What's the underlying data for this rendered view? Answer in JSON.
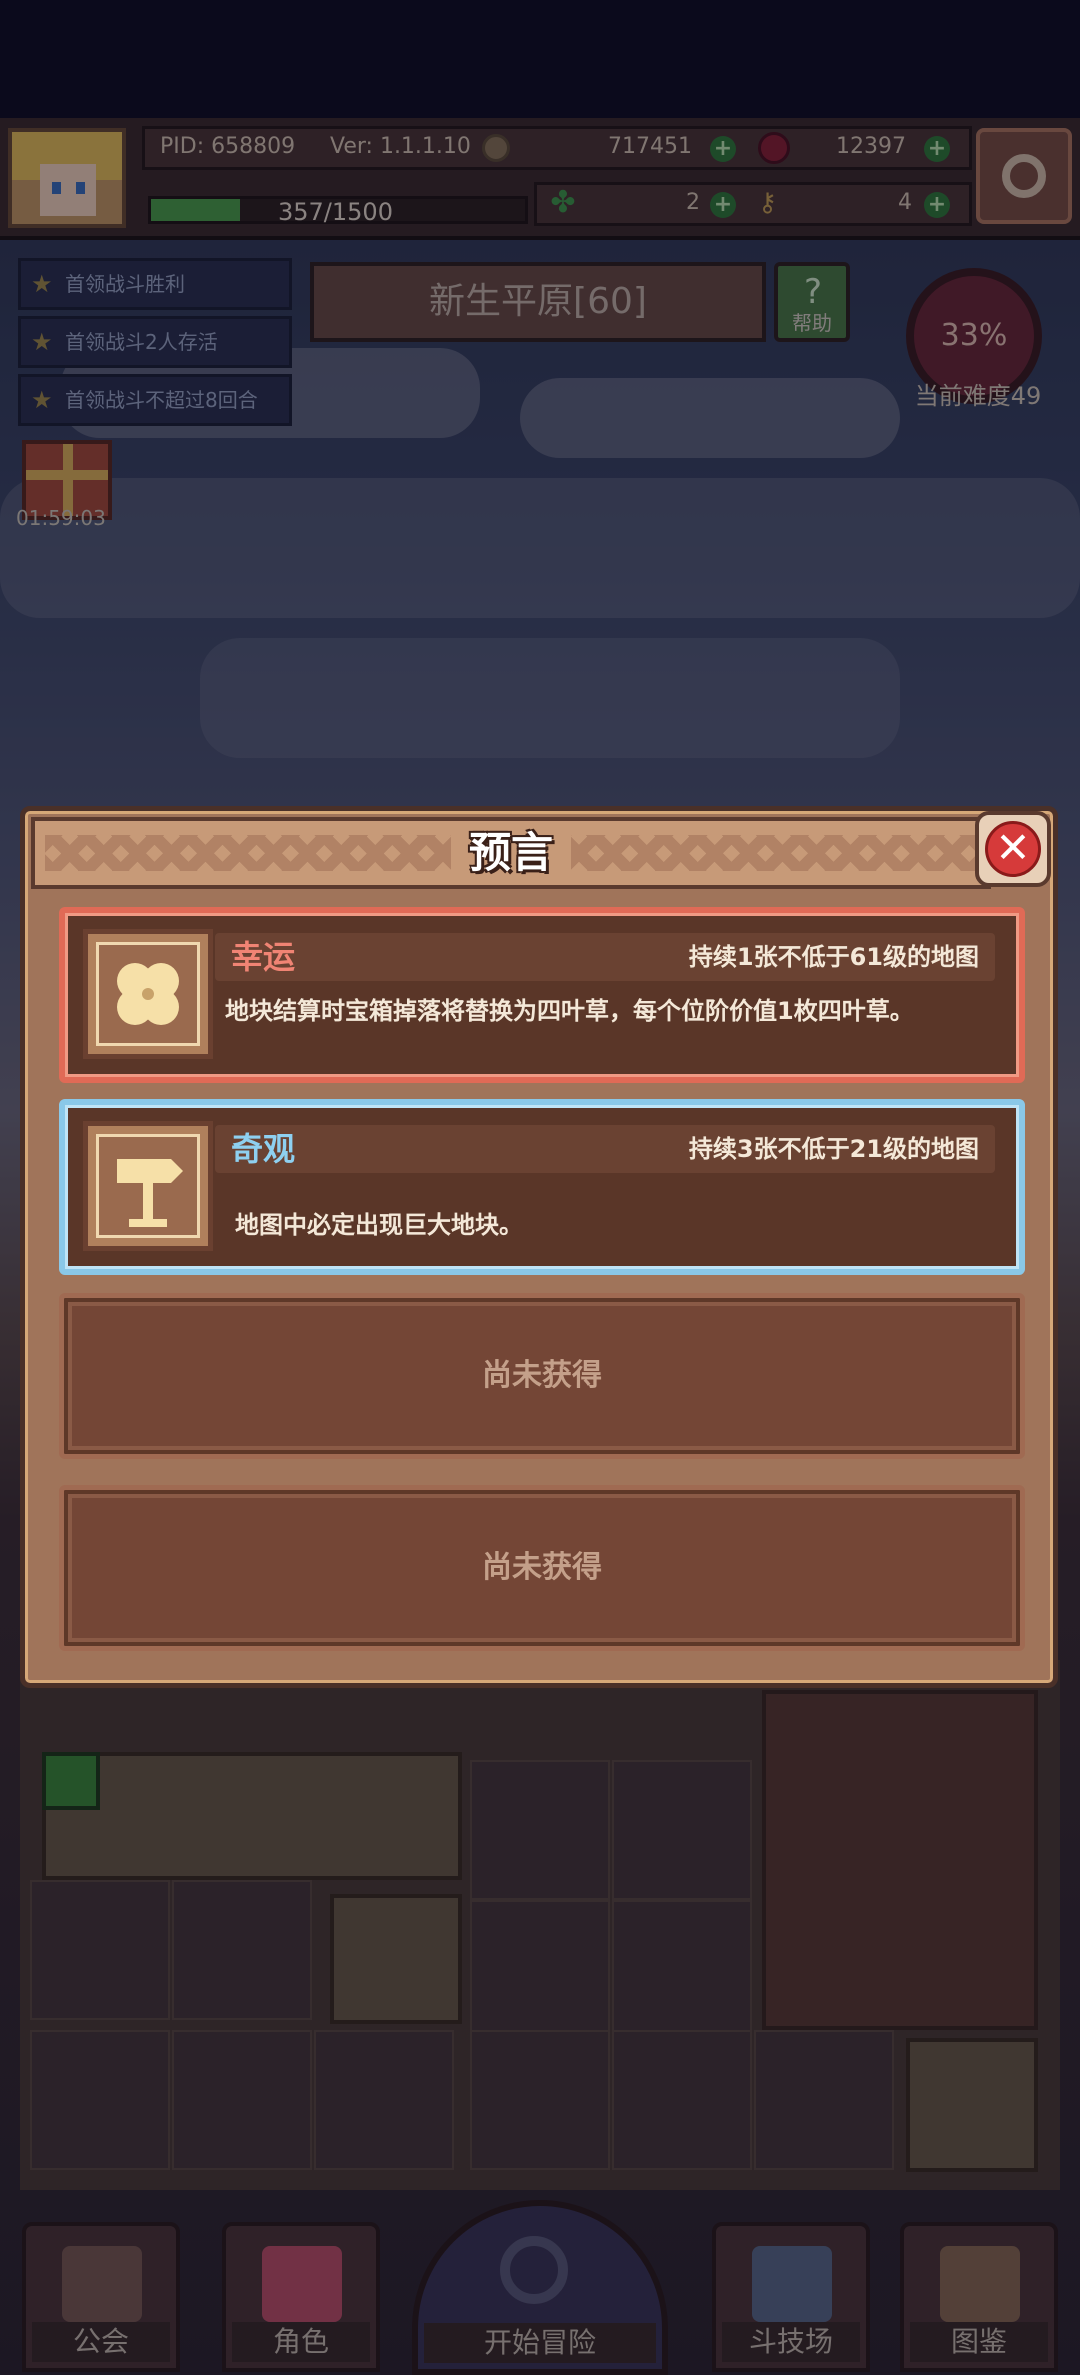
{
  "hud": {
    "pid": "PID: 658809",
    "version": "Ver: 1.1.1.10",
    "gold": "717451",
    "gems": "12397",
    "stamina": "357/1500",
    "stamina_fraction": 0.238,
    "clover_count": "2",
    "key_count": "4"
  },
  "quests": [
    "首领战斗胜利",
    "首领战斗2人存活",
    "首领战斗不超过8回合"
  ],
  "area": {
    "title": "新生平原[60]",
    "help_label": "帮助"
  },
  "difficulty": {
    "percent": "33%",
    "label": "当前难度49"
  },
  "gift": {
    "timer": "01:59:03"
  },
  "modal": {
    "title": "预言",
    "close_symbol": "✕",
    "cards": [
      {
        "name": "幸运",
        "duration": "持续1张不低于61级的地图",
        "description": "地块结算时宝箱掉落将替换为四叶草，每个位阶价值1枚四叶草。",
        "icon": "four-leaf-clover-icon",
        "color": "#e06a56"
      },
      {
        "name": "奇观",
        "duration": "持续3张不低于21级的地图",
        "description": "地图中必定出现巨大地块。",
        "icon": "signpost-icon",
        "color": "#8ac8e8"
      }
    ],
    "empty_slots": [
      "尚未获得",
      "尚未获得"
    ]
  },
  "bottom_nav": {
    "guild": "公会",
    "character": "角色",
    "start": "开始冒险",
    "arena": "斗技场",
    "codex": "图鉴"
  }
}
